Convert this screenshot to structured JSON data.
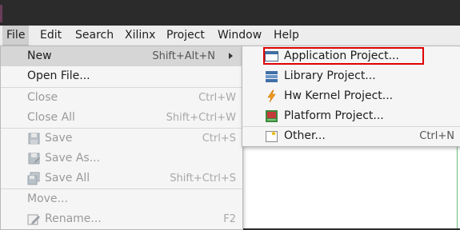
{
  "menubar": {
    "items": [
      {
        "label": "File",
        "active": true
      },
      {
        "label": "Edit"
      },
      {
        "label": "Search"
      },
      {
        "label": "Xilinx"
      },
      {
        "label": "Project"
      },
      {
        "label": "Window"
      },
      {
        "label": "Help"
      }
    ]
  },
  "file_menu": {
    "new": {
      "label": "New",
      "shortcut": "Shift+Alt+N"
    },
    "open_file": {
      "label": "Open File..."
    },
    "close": {
      "label": "Close",
      "shortcut": "Ctrl+W"
    },
    "close_all": {
      "label": "Close All",
      "shortcut": "Shift+Ctrl+W"
    },
    "save": {
      "label": "Save",
      "shortcut": "Ctrl+S"
    },
    "save_as": {
      "label": "Save As..."
    },
    "save_all": {
      "label": "Save All",
      "shortcut": "Shift+Ctrl+S"
    },
    "move": {
      "label": "Move..."
    },
    "rename": {
      "label": "Rename...",
      "shortcut": "F2"
    }
  },
  "new_submenu": {
    "application_project": {
      "label": "Application Project...",
      "icon": "application-project-icon"
    },
    "library_project": {
      "label": "Library Project...",
      "icon": "library-project-icon"
    },
    "hw_kernel_project": {
      "label": "Hw Kernel Project...",
      "icon": "hw-kernel-icon"
    },
    "platform_project": {
      "label": "Platform Project...",
      "icon": "platform-project-icon"
    },
    "other": {
      "label": "Other...",
      "shortcut": "Ctrl+N",
      "icon": "wizard-icon"
    }
  },
  "colors": {
    "highlight_border": "#e00000",
    "menu_background": "#f5f5f5",
    "hover_background": "#d6d6d6"
  }
}
